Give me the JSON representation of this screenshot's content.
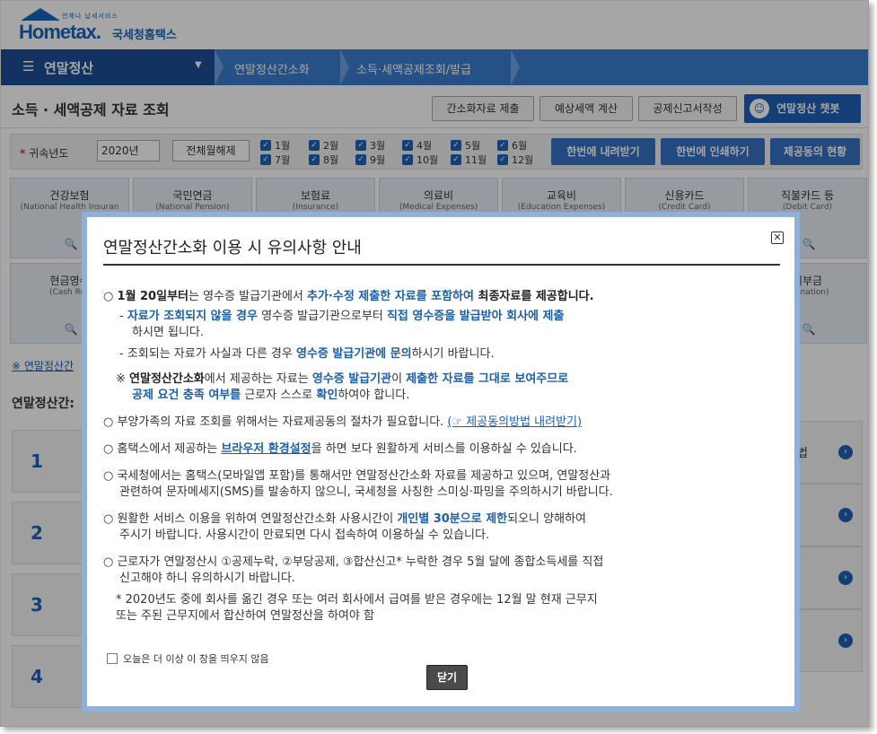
{
  "header": {
    "logo_tag": "언제나 납세서비스",
    "logo_word": "Hometax.",
    "logo_kor": "국세청홈택스"
  },
  "nav": {
    "menu_label": "연말정산",
    "crumbs": [
      "연말정산간소화",
      "소득·세액공제조회/발급"
    ]
  },
  "page": {
    "title": "소득 · 세액공제 자료 조회",
    "buttons": [
      "간소화자료 제출",
      "예상세액 계산",
      "공제신고서작성"
    ],
    "quick_label": "연말정산 챗봇"
  },
  "filter": {
    "year_label": "귀속년도",
    "year_value": "2020년",
    "clear_label": "전체월해제",
    "months": [
      "1월",
      "2월",
      "3월",
      "4월",
      "5월",
      "6월",
      "7월",
      "8월",
      "9월",
      "10월",
      "11월",
      "12월"
    ],
    "actions": [
      "한번에 내려받기",
      "한번에 인쇄하기",
      "제공동의 현황"
    ]
  },
  "categories": [
    {
      "ko": "건강보험",
      "en": "(National Health Insuran"
    },
    {
      "ko": "국민연금",
      "en": "(National Pension)"
    },
    {
      "ko": "보험료",
      "en": "(Insurance)"
    },
    {
      "ko": "의료비",
      "en": "(Medical Expenses)"
    },
    {
      "ko": "교육비",
      "en": "(Education Expenses)"
    },
    {
      "ko": "신용카드",
      "en": "(Credit Card)"
    },
    {
      "ko": "직불카드 등",
      "en": "(Debit Card)"
    },
    {
      "ko": "현금영수",
      "en": "(Cash Rec"
    },
    {
      "ko": "기부금",
      "en": "(Donation)"
    }
  ],
  "background": {
    "note": "※ 연말정산간",
    "section_title": "연말정산간:",
    "steps": [
      "1",
      "2",
      "3",
      "4"
    ],
    "right_label": "법"
  },
  "modal": {
    "title": "연말정산간소화 이용 시 유의사항 안내",
    "item1": {
      "a": "○ ",
      "b": "1월 20일부터",
      "c": "는 영수증 발급기관에서 ",
      "d": "추가·수정 제출한 자료를 포함하여",
      "e": " 최종자료를 제공합니다."
    },
    "sub1": {
      "a": "- ",
      "b": "자료가 조회되지 않을 경우",
      "c": " 영수증 발급기관으로부터 ",
      "d": "직접 영수증을 발급받아 회사에 제출",
      "e": "하시면 됩니다."
    },
    "sub2": {
      "a": "- 조회되는 자료가 사실과 다른 경우 ",
      "b": "영수증 발급기관에 문의",
      "c": "하시기 바랍니다."
    },
    "note1": {
      "a": "※ ",
      "b": "연말정산간소화",
      "c": "에서 제공하는 자료는 ",
      "d": "영수증 발급기관",
      "e": "이 ",
      "f": "제출한 자료를 그대로 보여주므로",
      "g": "공제 요건 충족 여부를",
      "h": " 근로자 스스로 ",
      "i": "확인",
      "j": "하여야 합니다."
    },
    "item2": {
      "a": "○ 부양가족의 자료 조회를 위해서는 자료제공동의 절차가 필요합니다. ",
      "b": "(☞ 제공동의방법 내려받기)"
    },
    "item3": {
      "a": "○ 홈택스에서 제공하는 ",
      "b": "브라우저 환경설정",
      "c": "을 하면 보다 원활하게 서비스를 이용하실 수 있습니다."
    },
    "item4": {
      "line1": "○ 국세청에서는 홈택스(모바일앱 포함)를 통해서만 연말정산간소화 자료를 제공하고 있으며, 연말정산과",
      "line2": "관련하여 문자메세지(SMS)를 발송하지 않으니, 국세청을 사칭한 스미싱·파밍을 주의하시기 바랍니다."
    },
    "item5": {
      "a": "○ 원활한 서비스 이용을 위하여 연말정산간소화 사용시간이 ",
      "b": "개인별 30분으로 제한",
      "c": "되오니 양해하여",
      "line2": "주시기 바랍니다. 사용시간이 만료되면 다시 접속하여 이용하실 수 있습니다."
    },
    "item6": {
      "line1": "○ 근로자가 연말정산시 ①공제누락, ②부당공제, ③합산신고* 누락한 경우 5월 달에 종합소득세를 직접",
      "line2": "신고해야 하니 유의하시기 바랍니다.",
      "line3": "* 2020년도 중에 회사를 옮긴 경우 또는 여러 회사에서 급여를 받은 경우에는 12월 말 현재 근무지",
      "line4": "또는 주된 근무지에서 합산하여 연말정산을 하여야 함"
    },
    "dont_show": "오늘은 더 이상 이 창을 띄우지 않음",
    "close_button": "닫기"
  }
}
